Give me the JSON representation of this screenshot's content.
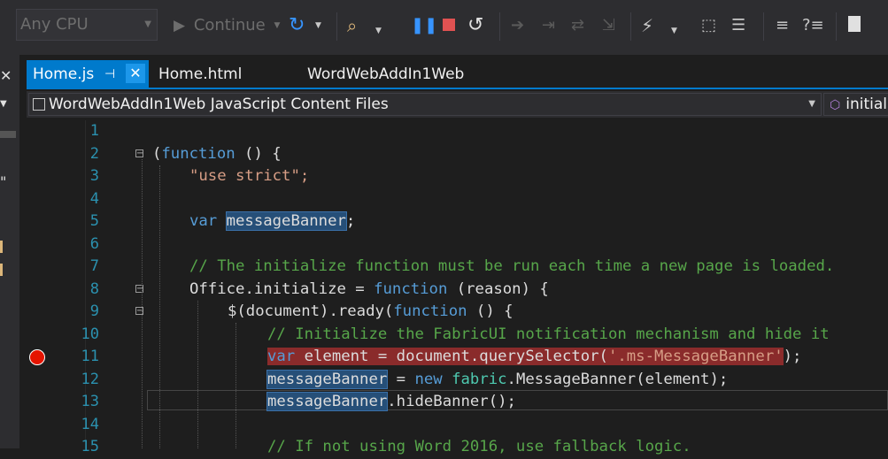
{
  "toolbar": {
    "platform": "Any CPU",
    "continue": "Continue",
    "icons": [
      "refresh-icon",
      "find-icon",
      "pause-icon",
      "stop-icon",
      "restart-icon",
      "step-icons",
      "bookmark-icon"
    ],
    "colors": {
      "pause": "#3794ff",
      "stop": "#e05252",
      "refresh": "#3794ff"
    }
  },
  "tabs": {
    "active": "Home.js",
    "pin": "⊣",
    "close": "✕",
    "others": [
      "Home.html",
      "WordWebAddIn1Web"
    ]
  },
  "nav": {
    "project": "WordWebAddIn1Web JavaScript Content Files",
    "member": "initial"
  },
  "code": {
    "line_numbers": [
      "1",
      "2",
      "3",
      "4",
      "5",
      "6",
      "7",
      "8",
      "9",
      "10",
      "11",
      "12",
      "13",
      "14",
      "15"
    ],
    "l2": [
      "(",
      "function",
      " () {"
    ],
    "l3": "\"use strict\";",
    "l5": [
      "var",
      " ",
      "messageBanner",
      ";"
    ],
    "l7": "// The initialize function must be run each time a new page is loaded.",
    "l8": [
      "Office",
      ".initialize = ",
      "function",
      " (reason) {"
    ],
    "l9": [
      "$(document).ready(",
      "function",
      " () {"
    ],
    "l10": "// Initialize the FabricUI notification mechanism and hide it",
    "l11": [
      "var",
      " element = document.querySelector(",
      "'.ms-MessageBanner'",
      ");"
    ],
    "l12": [
      "messageBanner",
      " = ",
      "new",
      " ",
      "fabric",
      ".MessageBanner(element);"
    ],
    "l13": [
      "messageBanner",
      ".hideBanner();"
    ],
    "l15": "// If not using Word 2016, use fallback logic."
  },
  "colors": {
    "accent": "#007acc",
    "keyword": "#569cd6",
    "string": "#d69d85",
    "comment": "#57a64a",
    "type": "#4ec9b0",
    "line_number": "#2b91af",
    "breakpoint": "#e51400"
  }
}
